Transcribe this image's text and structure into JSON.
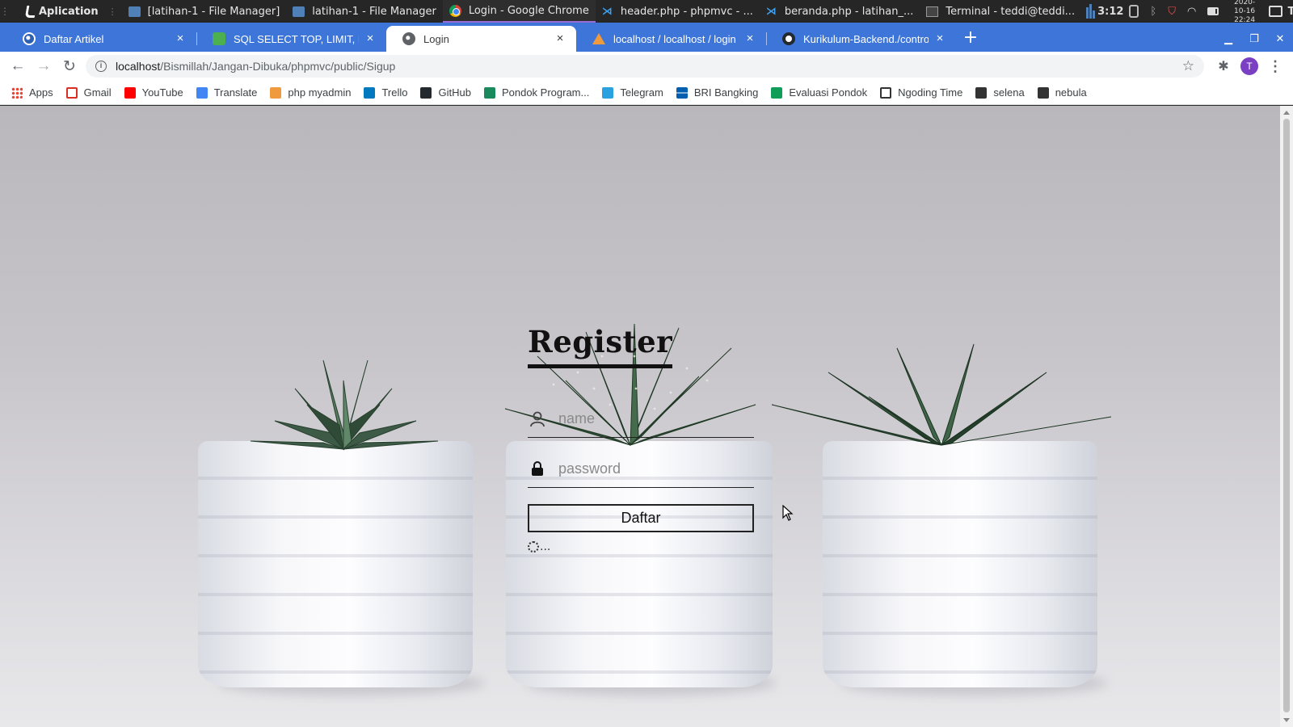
{
  "os_panel": {
    "app_menu": "Aplication",
    "tasks": [
      {
        "label": "[latihan-1 - File Manager]",
        "icon": "folder-icon"
      },
      {
        "label": "latihan-1 - File Manager",
        "icon": "folder-icon"
      },
      {
        "label": "Login - Google Chrome",
        "icon": "chrome-icon"
      },
      {
        "label": "header.php - phpmvc - ...",
        "icon": "vscode-icon"
      },
      {
        "label": "beranda.php - latihan_...",
        "icon": "vscode-icon"
      },
      {
        "label": "Terminal - teddi@teddi...",
        "icon": "terminal-icon"
      }
    ],
    "cpu_time": "3:12",
    "date": "2020-10-16",
    "time": "22:24",
    "user": "Teddi"
  },
  "tabs": [
    {
      "label": "Daftar Artikel",
      "icon": "globe-icon"
    },
    {
      "label": "SQL SELECT TOP, LIMIT, ROWNUM",
      "icon": "w3schools-icon"
    },
    {
      "label": "Login",
      "icon": "globe-icon"
    },
    {
      "label": "localhost / localhost / login / ...",
      "icon": "phpmyadmin-icon"
    },
    {
      "label": "Kurikulum-Backend./controllers",
      "icon": "github-icon"
    }
  ],
  "active_tab_index": 2,
  "address": {
    "host": "localhost",
    "path": "/Bismillah/Jangan-Dibuka/phpmvc/public/Sigup"
  },
  "profile_initial": "T",
  "bookmarks": [
    {
      "label": "Apps",
      "icon": "apps-icon"
    },
    {
      "label": "Gmail",
      "icon": "gmail-icon"
    },
    {
      "label": "YouTube",
      "icon": "youtube-icon"
    },
    {
      "label": "Translate",
      "icon": "translate-icon"
    },
    {
      "label": "php myadmin",
      "icon": "phpmyadmin-icon"
    },
    {
      "label": "Trello",
      "icon": "trello-icon"
    },
    {
      "label": "GitHub",
      "icon": "github-icon"
    },
    {
      "label": "Pondok Program...",
      "icon": "pondok-icon"
    },
    {
      "label": "Telegram",
      "icon": "telegram-icon"
    },
    {
      "label": "BRI Bangking",
      "icon": "bri-icon"
    },
    {
      "label": "Evaluasi Pondok",
      "icon": "sheets-icon"
    },
    {
      "label": "Ngoding Time",
      "icon": "check-circle-icon"
    },
    {
      "label": "selena",
      "icon": "globe-icon"
    },
    {
      "label": "nebula",
      "icon": "globe-icon"
    }
  ],
  "form": {
    "title": "Register",
    "name_placeholder": "name",
    "password_placeholder": "password",
    "submit_label": "Daftar",
    "loading_text": "..."
  }
}
